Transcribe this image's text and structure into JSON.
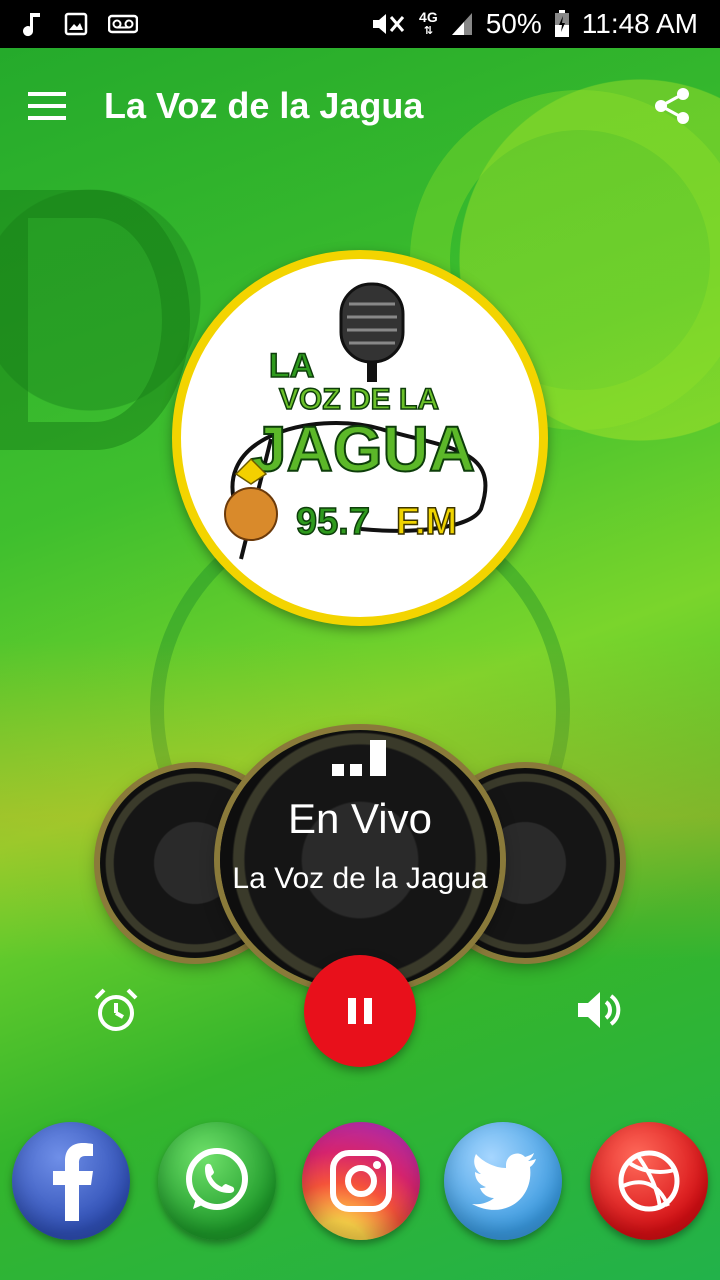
{
  "status_bar": {
    "battery": "50%",
    "time": "11:48 AM",
    "network": "4G",
    "left_icons": [
      "music-note-icon",
      "image-icon",
      "voicemail-icon"
    ],
    "right_icons": [
      "mute-icon",
      "network-4g-icon",
      "signal-icon",
      "battery-icon"
    ]
  },
  "app_bar": {
    "title": "La Voz de la Jagua",
    "menu_icon": "hamburger-menu-icon",
    "share_icon": "share-icon"
  },
  "logo": {
    "line1": "LA",
    "line2": "VOZ DE LA",
    "line3": "JAGUA",
    "frequency": "95.7",
    "band": "F.M"
  },
  "player": {
    "status": "En Vivo",
    "station": "La Voz de la Jagua",
    "signal_icon": "signal-bars-icon",
    "alarm_icon": "alarm-clock-icon",
    "pause_icon": "pause-icon",
    "volume_icon": "volume-icon"
  },
  "social": [
    {
      "name": "facebook",
      "icon": "facebook-icon",
      "color": "#3b5bbf"
    },
    {
      "name": "whatsapp",
      "icon": "whatsapp-icon",
      "color": "#27a830"
    },
    {
      "name": "instagram",
      "icon": "instagram-icon",
      "color": "#e8365a"
    },
    {
      "name": "twitter",
      "icon": "twitter-icon",
      "color": "#4aa8e8"
    },
    {
      "name": "dribbble",
      "icon": "dribbble-icon",
      "color": "#e01818"
    }
  ],
  "colors": {
    "accent_red": "#e8101b",
    "logo_border": "#f3d400",
    "background_green": "#2fb52a"
  }
}
